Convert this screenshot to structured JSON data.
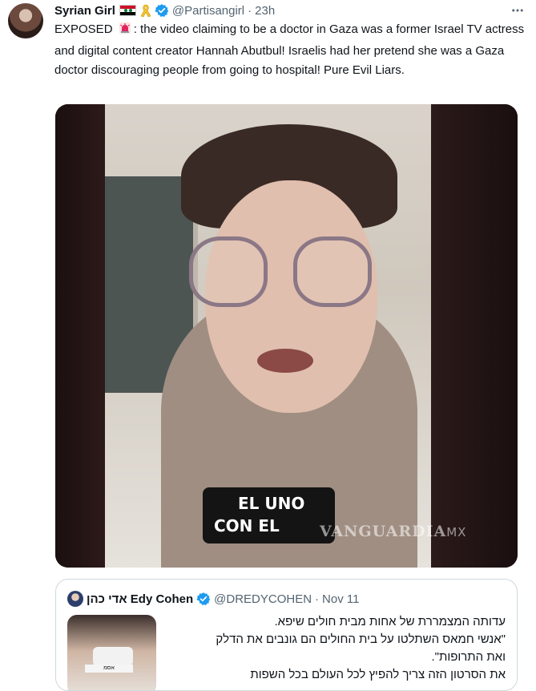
{
  "tweet": {
    "author_name": "Syrian Girl",
    "author_handle": "@Partisangirl",
    "separator": "·",
    "time": "23h",
    "text_before_emoji": "EXPOSED",
    "text_after_emoji": ": the video claiming to be a doctor in Gaza was a former Israel TV actress and digital content creator Hannah Abutbul! Israelis had her pretend she was a Gaza doctor discouraging people from going to hospital! Pure Evil Liars.",
    "icons": [
      "syria-flag-icon",
      "yellow-ribbon-icon",
      "verified-badge-icon",
      "more-options-icon",
      "siren-icon"
    ]
  },
  "video": {
    "caption_line1": "EL UNO",
    "caption_line2": "CON EL",
    "watermark": "VANGUARDIA",
    "watermark_suffix": "MX"
  },
  "quote": {
    "author_name": "אדי כהן Edy Cohen",
    "author_handle": "@DREDYCOHEN",
    "separator": "·",
    "date": "Nov 11",
    "lines": [
      "עדותה המצמררת של אחות מבית חולים שיפא.",
      "\"אנשי חמאס השתלטו על בית החולים הם גונבים את הדלק",
      "ואת התרופות\".",
      "את הסרטון הזה צריך להפיץ לכל העולם בכל השפות"
    ],
    "thumb_tag": "אסמ"
  },
  "colors": {
    "verified": "#1d9bf0",
    "secondary_text": "#536471",
    "border": "#cfd9de"
  }
}
